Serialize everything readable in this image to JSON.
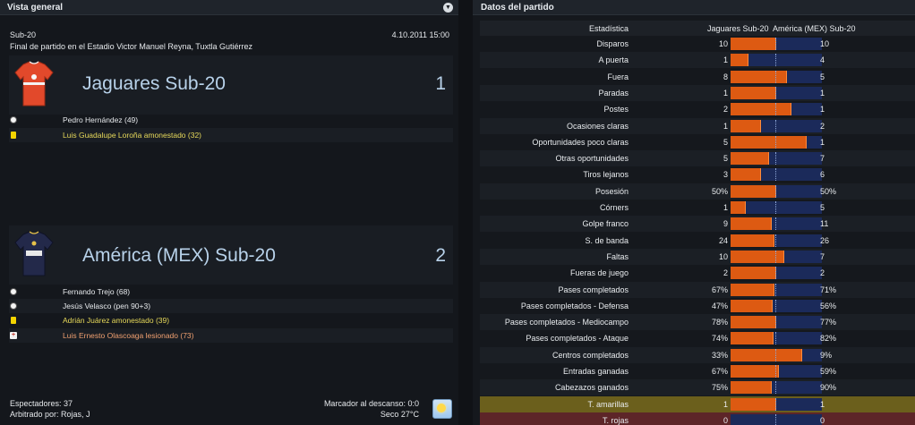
{
  "left": {
    "title": "Vista general",
    "competition": "Sub-20",
    "datetime": "4.10.2011 15:00",
    "summary": "Final de partido en el Estadio Victor Manuel Reyna, Tuxtla Gutiérrez",
    "home": {
      "name": "Jaguares Sub-20",
      "score": "1",
      "events": [
        {
          "type": "goal",
          "text": "Pedro Hernández (49)"
        },
        {
          "type": "yellow",
          "text": "Luis Guadalupe Loroña amonestado (32)"
        }
      ]
    },
    "away": {
      "name": "América (MEX) Sub-20",
      "score": "2",
      "events": [
        {
          "type": "goal",
          "text": "Fernando Trejo (68)"
        },
        {
          "type": "goal",
          "text": "Jesús Velasco (pen 90+3)"
        },
        {
          "type": "yellow",
          "text": "Adrián Juárez amonestado (39)"
        },
        {
          "type": "injury",
          "text": "Luis Ernesto Olascoaga lesionado (73)"
        }
      ]
    },
    "attendance": "Espectadores: 37",
    "referee": "Arbitrado por: Rojas, J",
    "halftime": "Marcador al descanso: 0:0",
    "weather": "Seco 27°C"
  },
  "right": {
    "title": "Datos del partido",
    "header": {
      "stat": "Estadística",
      "home": "Jaguares Sub-20",
      "away": "América (MEX) Sub-20"
    },
    "stats": [
      {
        "label": "Disparos",
        "home": "10",
        "away": "10",
        "share": 0.5
      },
      {
        "label": "A puerta",
        "home": "1",
        "away": "4",
        "share": 0.2
      },
      {
        "label": "Fuera",
        "home": "8",
        "away": "5",
        "share": 0.615
      },
      {
        "label": "Paradas",
        "home": "1",
        "away": "1",
        "share": 0.5
      },
      {
        "label": "Postes",
        "home": "2",
        "away": "1",
        "share": 0.667
      },
      {
        "label": "Ocasiones claras",
        "home": "1",
        "away": "2",
        "share": 0.333
      },
      {
        "label": "Oportunidades poco claras",
        "home": "5",
        "away": "1",
        "share": 0.833
      },
      {
        "label": "Otras oportunidades",
        "home": "5",
        "away": "7",
        "share": 0.417
      },
      {
        "label": "Tiros lejanos",
        "home": "3",
        "away": "6",
        "share": 0.333
      },
      {
        "label": "Posesión",
        "home": "50%",
        "away": "50%",
        "share": 0.5
      },
      {
        "label": "Córners",
        "home": "1",
        "away": "5",
        "share": 0.167
      },
      {
        "label": "Golpe franco",
        "home": "9",
        "away": "11",
        "share": 0.45
      },
      {
        "label": "S. de banda",
        "home": "24",
        "away": "26",
        "share": 0.48
      },
      {
        "label": "Faltas",
        "home": "10",
        "away": "7",
        "share": 0.588
      },
      {
        "label": "Fueras de juego",
        "home": "2",
        "away": "2",
        "share": 0.5
      },
      {
        "label": "Pases completados",
        "home": "67%",
        "away": "71%",
        "share": 0.485
      },
      {
        "label": "Pases completados - Defensa",
        "home": "47%",
        "away": "56%",
        "share": 0.456
      },
      {
        "label": "Pases completados - Mediocampo",
        "home": "78%",
        "away": "77%",
        "share": 0.503
      },
      {
        "label": "Pases completados - Ataque",
        "home": "74%",
        "away": "82%",
        "share": 0.474
      },
      {
        "label": "Centros completados",
        "home": "33%",
        "away": "9%",
        "share": 0.786
      },
      {
        "label": "Entradas ganadas",
        "home": "67%",
        "away": "59%",
        "share": 0.532
      },
      {
        "label": "Cabezazos ganados",
        "home": "75%",
        "away": "90%",
        "share": 0.455
      },
      {
        "label": "T. amarillas",
        "home": "1",
        "away": "1",
        "share": 0.5
      },
      {
        "label": "T. rojas",
        "home": "0",
        "away": "0",
        "share": 0.0
      }
    ]
  },
  "colors": {
    "home_bar": "#dd5a12",
    "away_bar": "#1b2a5a",
    "team_name": "#b8d2ea",
    "yellow_text": "#e7d95a",
    "injury_text": "#f0a070"
  }
}
